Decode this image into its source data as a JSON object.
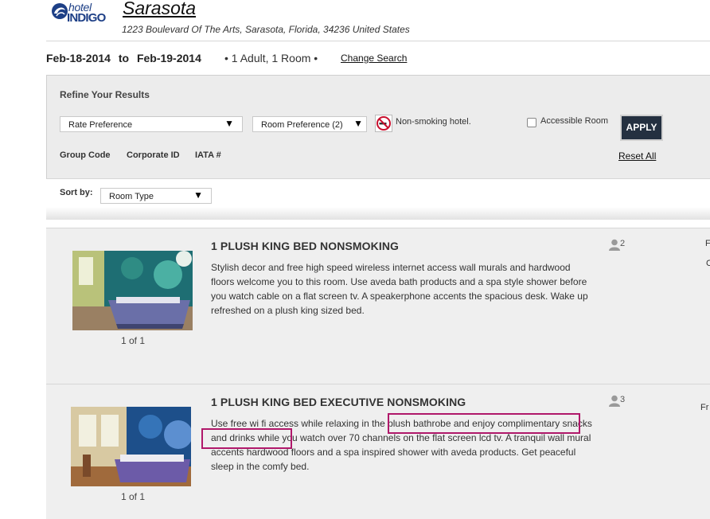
{
  "header": {
    "logo_top": "hotel",
    "logo_bottom": "INDIGO",
    "city": "Sarasota",
    "address": "1223 Boulevard Of The Arts, Sarasota, Florida, 34236  United States"
  },
  "search": {
    "check_in": "Feb-18-2014",
    "to": "to",
    "check_out": "Feb-19-2014",
    "guests": "•  1 Adult, 1 Room  •",
    "change_link": "Change Search"
  },
  "refine": {
    "title": "Refine Your Results",
    "rate_preference": "Rate Preference",
    "room_preference": "Room Preference (2)",
    "non_smoking": "Non-smoking hotel.",
    "accessible": "Accessible Room",
    "apply": "APPLY",
    "group_code": "Group Code",
    "corporate_id": "Corporate ID",
    "iata": "IATA #",
    "reset": "Reset All",
    "arrow": "▼"
  },
  "sort": {
    "label": "Sort by:",
    "value": "Room Type"
  },
  "rooms": [
    {
      "title": "1 PLUSH KING BED NONSMOKING",
      "description": "Stylish decor and free high speed wireless internet access wall murals and hardwood floors welcome you to this room. Use aveda bath products and a spa style shower before you watch cable on a flat screen tv. A speakerphone accents the spacious desk. Wake up refreshed on a plush king sized bed.",
      "photo_count": "1 of 1",
      "occupancy": "2",
      "edge_top": "F",
      "edge_bottom": "C"
    },
    {
      "title": "1 PLUSH KING BED EXECUTIVE NONSMOKING",
      "description": "Use free wi fi access while relaxing in the plush bathrobe and enjoy complimentary snacks and drinks while you watch over 70 channels on the flat screen lcd tv. A tranquil wall mural accents hardwood floors and a spa inspired shower with aveda products. Get peaceful sleep in the comfy bed.",
      "photo_count": "1 of 1",
      "occupancy": "3",
      "edge_top": "Fr"
    }
  ],
  "colors": {
    "brand": "#1d3f86",
    "apply_bg": "#243040",
    "highlight": "#b0186a"
  }
}
